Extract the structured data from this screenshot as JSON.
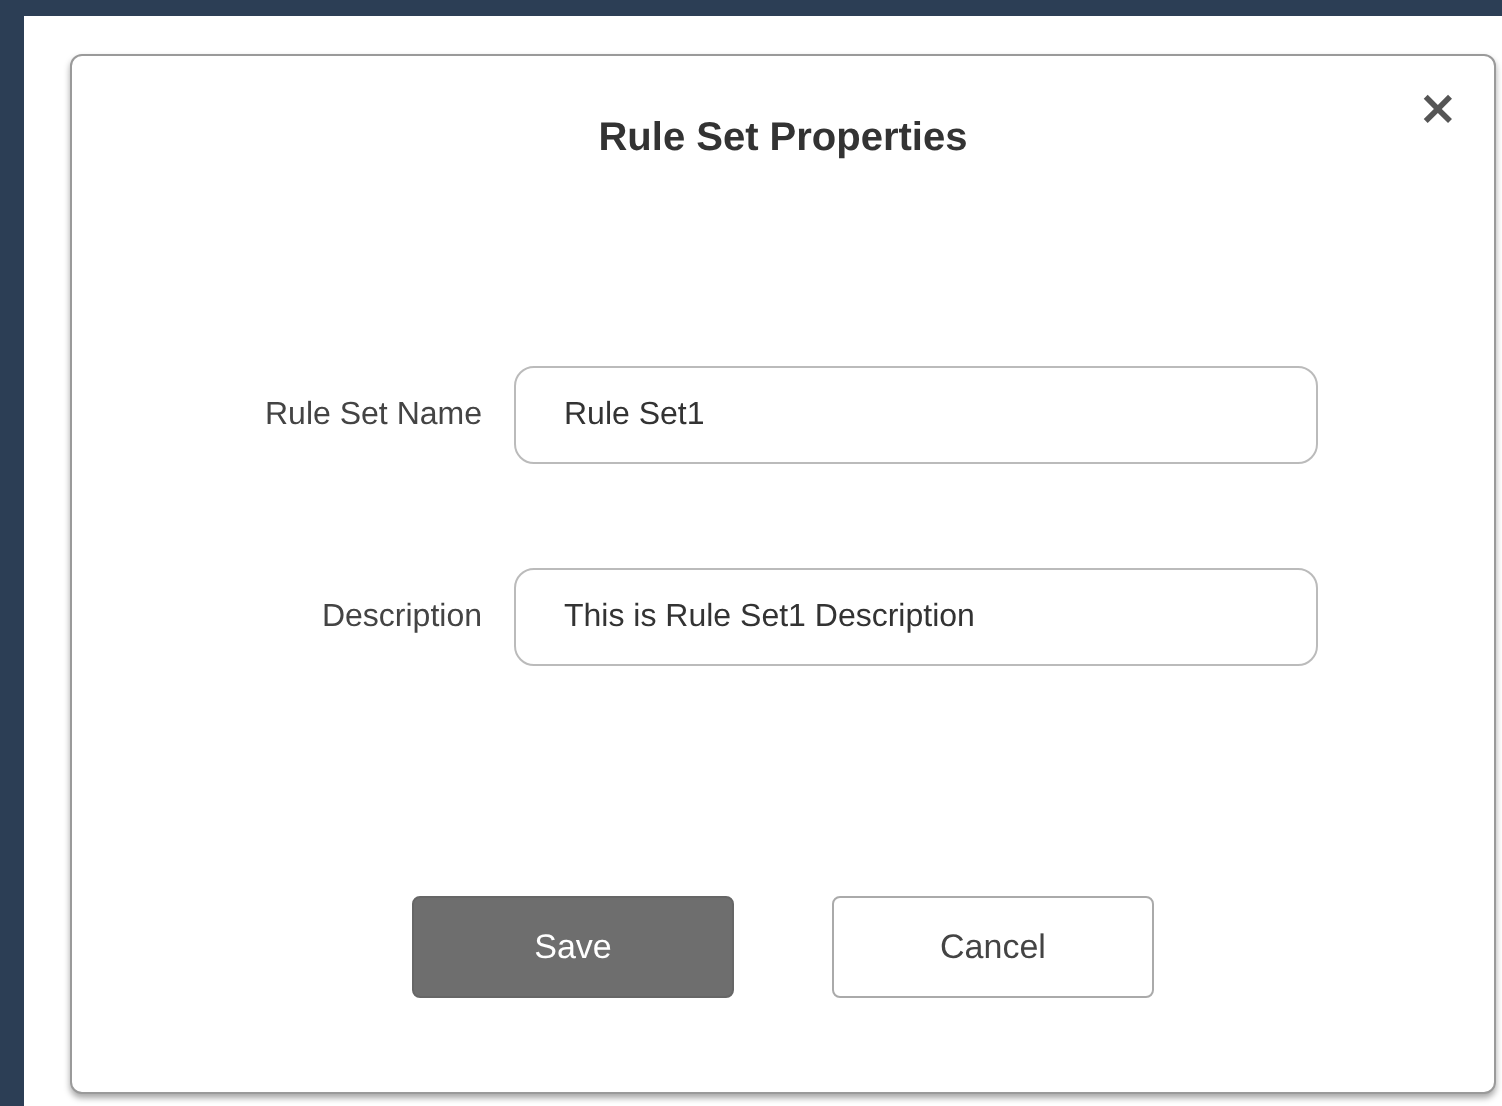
{
  "dialog": {
    "title": "Rule Set Properties",
    "close": "×",
    "fields": [
      {
        "label": "Rule Set Name",
        "value": "Rule Set1"
      },
      {
        "label": "Description",
        "value": "This is Rule Set1 Description"
      }
    ],
    "buttons": [
      {
        "label": "Save",
        "kind": "primary"
      },
      {
        "label": "Cancel",
        "kind": "secondary"
      }
    ]
  }
}
